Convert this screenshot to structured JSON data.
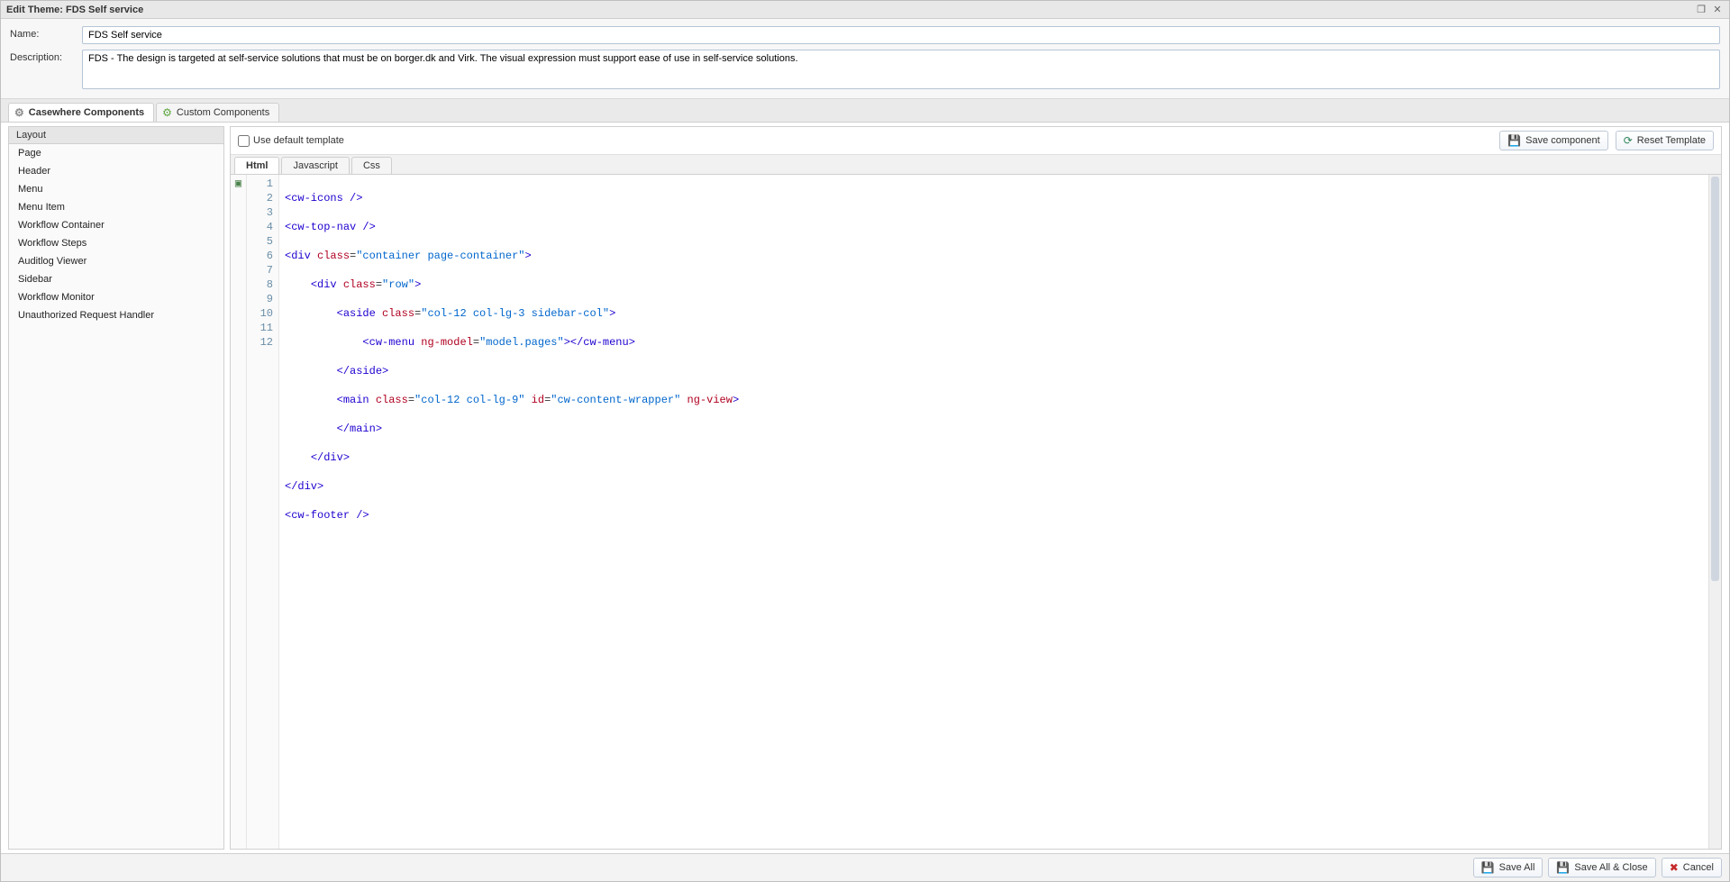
{
  "titlebar": {
    "title": "Edit Theme: FDS Self service"
  },
  "form": {
    "name_label": "Name:",
    "name_value": "FDS Self service",
    "desc_label": "Description:",
    "desc_value": "FDS - The design is targeted at self-service solutions that must be on borger.dk and Virk. The visual expression must support ease of use in self-service solutions."
  },
  "outer_tabs": {
    "casewhere": "Casewhere Components",
    "custom": "Custom Components"
  },
  "sidebar": {
    "header": "Layout",
    "items": [
      "Page",
      "Header",
      "Menu",
      "Menu Item",
      "Workflow Container",
      "Workflow Steps",
      "Auditlog Viewer",
      "Sidebar",
      "Workflow Monitor",
      "Unauthorized Request Handler"
    ]
  },
  "editor": {
    "use_default_label": "Use default template",
    "buttons": {
      "save_component": "Save component",
      "reset_template": "Reset Template"
    },
    "tabs": {
      "html": "Html",
      "js": "Javascript",
      "css": "Css"
    },
    "code": {
      "line_numbers": [
        "1",
        "2",
        "3",
        "4",
        "5",
        "6",
        "7",
        "8",
        "9",
        "10",
        "11",
        "12"
      ],
      "l1_tag": "cw-icons",
      "l2_tag": "cw-top-nav",
      "l3_div": "div",
      "l3_class_attr": "class",
      "l3_class_val": "\"container page-container\"",
      "l4_div": "div",
      "l4_class_attr": "class",
      "l4_class_val": "\"row\"",
      "l5_aside": "aside",
      "l5_class_attr": "class",
      "l5_class_val": "\"col-12 col-lg-3 sidebar-col\"",
      "l6_cwmenu": "cw-menu",
      "l6_ngmodel_attr": "ng-model",
      "l6_ngmodel_val": "\"model.pages\"",
      "l6_cwmenu_close": "cw-menu",
      "l7_aside_close": "aside",
      "l8_main": "main",
      "l8_class_attr": "class",
      "l8_class_val": "\"col-12 col-lg-9\"",
      "l8_id_attr": "id",
      "l8_id_val": "\"cw-content-wrapper\"",
      "l8_ngview_attr": "ng-view",
      "l9_main_close": "main",
      "l10_div_close": "div",
      "l11_div_close": "div",
      "l12_footer": "cw-footer"
    }
  },
  "footer": {
    "save_all": "Save All",
    "save_all_close": "Save All & Close",
    "cancel": "Cancel"
  }
}
